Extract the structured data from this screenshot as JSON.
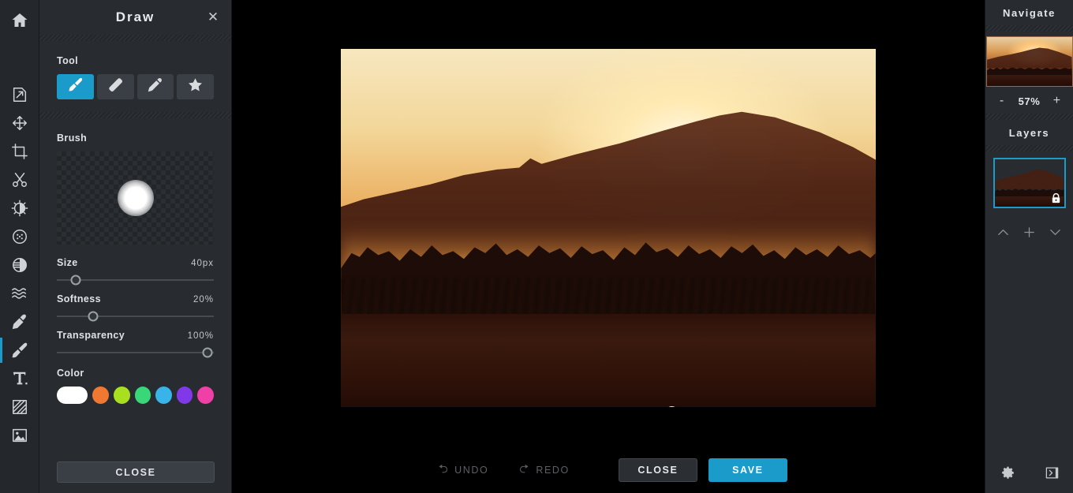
{
  "app": {
    "home_icon": "home-icon",
    "accent_color": "#1b9bc9",
    "panel_bg": "#282c31"
  },
  "toolbar": {
    "items": [
      {
        "name": "resize",
        "icon": "resize-icon"
      },
      {
        "name": "move",
        "icon": "move-icon"
      },
      {
        "name": "crop",
        "icon": "crop-icon"
      },
      {
        "name": "cut",
        "icon": "scissors-icon"
      },
      {
        "name": "adjust",
        "icon": "brightness-icon"
      },
      {
        "name": "effects",
        "icon": "effects-dots-icon"
      },
      {
        "name": "filters",
        "icon": "filter-halfcircle-icon"
      },
      {
        "name": "liquify",
        "icon": "waves-icon"
      },
      {
        "name": "retouch",
        "icon": "retouch-icon"
      },
      {
        "name": "draw",
        "icon": "brush-icon",
        "active": true
      },
      {
        "name": "text",
        "icon": "text-t-icon"
      },
      {
        "name": "frame",
        "icon": "frame-hatch-icon"
      },
      {
        "name": "sticker",
        "icon": "image-icon"
      }
    ]
  },
  "panel": {
    "title": "Draw",
    "close_icon": "close-x-icon",
    "tool_label": "Tool",
    "tools": [
      {
        "label": "Brush",
        "icon": "paintbrush-icon",
        "selected": true
      },
      {
        "label": "Eraser",
        "icon": "eraser-icon",
        "selected": false
      },
      {
        "label": "Pencil",
        "icon": "pencil-icon",
        "selected": false
      },
      {
        "label": "Shape",
        "icon": "star-icon",
        "selected": false
      }
    ],
    "brush_label": "Brush",
    "sliders": [
      {
        "name": "Size",
        "value": "40px",
        "percent": 12
      },
      {
        "name": "Softness",
        "value": "20%",
        "percent": 23
      },
      {
        "name": "Transparency",
        "value": "100%",
        "percent": 96
      }
    ],
    "color_label": "Color",
    "colors": [
      {
        "hex": "#ffffff",
        "selected": true
      },
      {
        "hex": "#f07830",
        "selected": false
      },
      {
        "hex": "#a8e020",
        "selected": false
      },
      {
        "hex": "#38d878",
        "selected": false
      },
      {
        "hex": "#38b4e8",
        "selected": false
      },
      {
        "hex": "#8038e8",
        "selected": false
      },
      {
        "hex": "#f040a8",
        "selected": false
      }
    ],
    "close_button": "CLOSE"
  },
  "bottom": {
    "undo": "UNDO",
    "redo": "REDO",
    "undo_icon": "undo-arrow-icon",
    "redo_icon": "redo-arrow-icon",
    "close": "CLOSE",
    "save": "SAVE"
  },
  "right": {
    "navigate_title": "Navigate",
    "zoom_minus": "-",
    "zoom_value": "57%",
    "zoom_plus": "+",
    "layers_title": "Layers",
    "layer_lock_icon": "lock-icon",
    "layer_up_icon": "chevron-up-icon",
    "layer_add_icon": "plus-icon",
    "layer_down_icon": "chevron-down-icon",
    "settings_icon": "gear-icon",
    "collapse_icon": "collapse-panel-icon"
  }
}
